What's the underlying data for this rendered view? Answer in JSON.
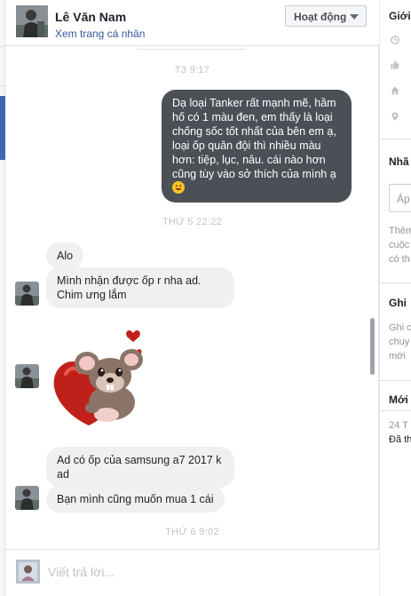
{
  "contact": {
    "name": "Lê Văn Nam",
    "profile_link": "Xem trang cá nhân",
    "status_button": "Hoạt động"
  },
  "thread": {
    "timestamp_1": "T3 9:17",
    "outgoing_message": "Dạ loại Tanker rất mạnh mẽ, hầm hố có 1 màu đen, em thấy là loại chống sốc tốt nhất của bên em ạ, loại ốp quân đội thì nhiều màu hơn: tiệp, lục, nâu. cái nào hơn cũng tùy vào sở thích của mình ạ",
    "timestamp_2": "THỨ 5 22:22",
    "msg_alo": "Alo",
    "msg_received": "Mình nhận được ốp r nha ad. Chim ưng lắm",
    "msg_samsung": "Ad có ốp của samsung a7 2017 k ad",
    "msg_buy": "Bạn mình cũng muốn mua 1 cái",
    "timestamp_3": "THỨ 6 9:02"
  },
  "composer": {
    "placeholder": "Viết trả lời..."
  },
  "sidebar": {
    "section1_title": "Giới",
    "section2_title": "Nhã",
    "section2_input": "Áp",
    "section2_text_1": "Thêm",
    "section2_text_2": "cuộc",
    "section2_text_3": "có th",
    "section3_title": "Ghi",
    "section3_text_1": "Ghi c",
    "section3_text_2": "chuy",
    "section3_text_3": "mới ",
    "section4_title": "Mới",
    "section4_text_1": "24 T",
    "section4_text_2": "Đã th"
  },
  "icons": {
    "sidebar": [
      "clock-icon",
      "like-icon",
      "home-icon",
      "location-icon"
    ],
    "emoji": "smiley-emoji-icon",
    "sticker": "mouse-heart-sticker-icon"
  },
  "colors": {
    "outgoing_bubble": "#4b4f56",
    "incoming_bubble": "#f1f0f0",
    "link": "#365899",
    "accent": "#4267b2"
  }
}
